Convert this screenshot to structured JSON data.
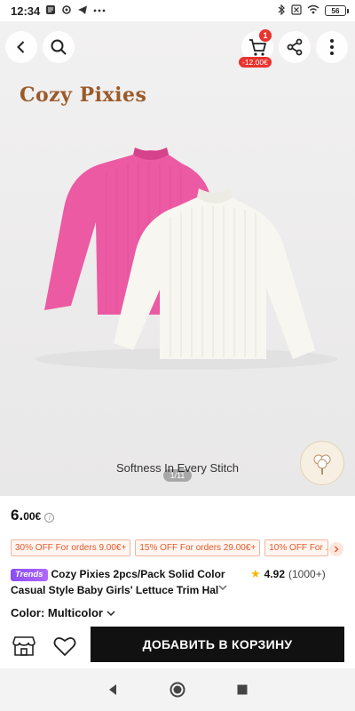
{
  "status_bar": {
    "time": "12:34",
    "battery": "56"
  },
  "top_nav": {
    "cart_badge": "1",
    "cart_discount": "-12.00€"
  },
  "hero": {
    "brand_logo": "Cozy Pixies",
    "caption": "Softness In Every Stitch",
    "page_indicator": "1/11"
  },
  "product": {
    "price_int": "6.",
    "price_dec": "00€",
    "coupons": [
      "30% OFF For orders 9.00€+",
      "15% OFF For orders 29.00€+",
      "10% OFF For ..."
    ],
    "tag": "Trends",
    "title": "Cozy Pixies 2pcs/Pack Solid Color Casual Style Baby Girls' Lettuce Trim Hal",
    "rating_value": "4.92",
    "rating_count": "(1000+)",
    "color_label": "Color: Multicolor"
  },
  "bottom_bar": {
    "add_to_cart": "ДОБАВИТЬ В КОРЗИНУ"
  },
  "colors": {
    "accent_red": "#e8332e",
    "coupon_orange": "#e05a2a",
    "trends_purple": "#8a4cf0",
    "cta_black": "#111111",
    "star": "#f5b800"
  }
}
